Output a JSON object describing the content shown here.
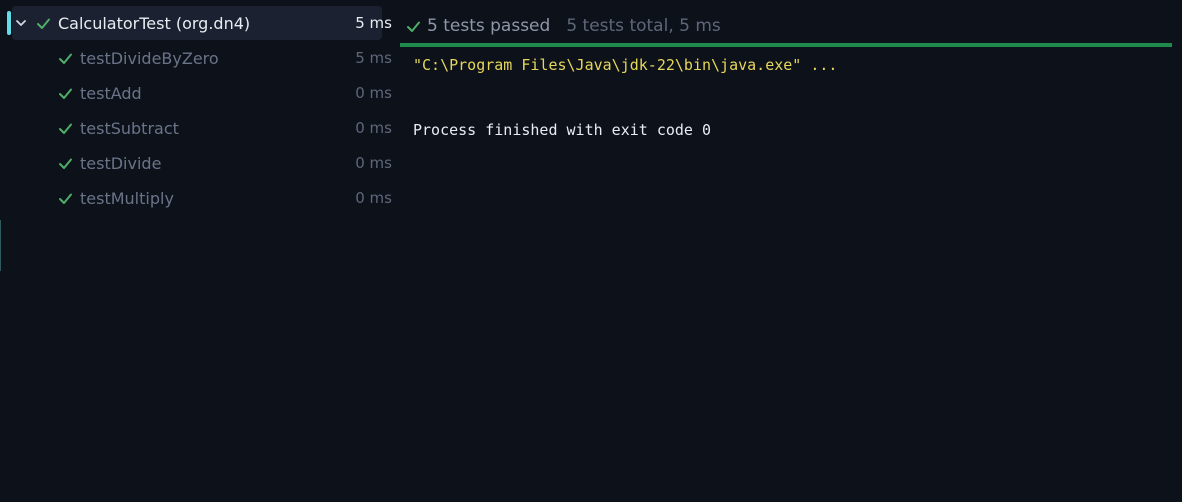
{
  "colors": {
    "background": "#0d111a",
    "pass_green": "#4fae68",
    "progress_green": "#1e8a4c",
    "command_yellow": "#e6d75a",
    "focus_cyan": "#5fdde8"
  },
  "tree": {
    "root": {
      "label": "CalculatorTest (org.dn4)",
      "duration": "5 ms",
      "expanded": true,
      "icon": "check-icon"
    },
    "children": [
      {
        "label": "testDivideByZero",
        "duration": "5 ms",
        "icon": "check-icon"
      },
      {
        "label": "testAdd",
        "duration": "0 ms",
        "icon": "check-icon"
      },
      {
        "label": "testSubtract",
        "duration": "0 ms",
        "icon": "check-icon"
      },
      {
        "label": "testDivide",
        "duration": "0 ms",
        "icon": "check-icon"
      },
      {
        "label": "testMultiply",
        "duration": "0 ms",
        "icon": "check-icon"
      }
    ]
  },
  "console": {
    "summary_passed": "5 tests passed",
    "summary_total": "5 tests total, 5 ms",
    "progress_fraction": 1.0,
    "command_line": "\"C:\\Program Files\\Java\\jdk-22\\bin\\java.exe\" ...",
    "exit_line": "Process finished with exit code 0"
  }
}
